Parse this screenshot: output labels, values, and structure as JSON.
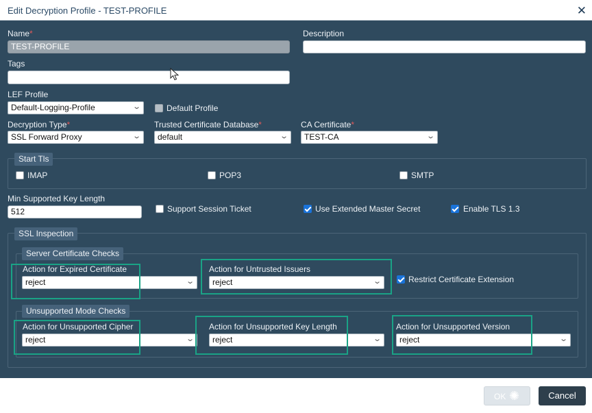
{
  "dialog": {
    "title": "Edit Decryption Profile - TEST-PROFILE"
  },
  "fields": {
    "name": {
      "label": "Name",
      "required": "*",
      "value": "TEST-PROFILE"
    },
    "description": {
      "label": "Description",
      "value": ""
    },
    "tags": {
      "label": "Tags",
      "value": ""
    },
    "lef_profile": {
      "label": "LEF Profile",
      "value": "Default-Logging-Profile"
    },
    "default_profile": {
      "label": "Default Profile",
      "checked": false
    },
    "decryption_type": {
      "label": "Decryption Type",
      "required": "*",
      "value": "SSL Forward Proxy"
    },
    "trusted_cert_db": {
      "label": "Trusted Certificate Database",
      "required": "*",
      "value": "default"
    },
    "ca_certificate": {
      "label": "CA Certificate",
      "required": "*",
      "value": "TEST-CA"
    }
  },
  "start_tls": {
    "legend": "Start Tls",
    "options": [
      {
        "label": "IMAP",
        "checked": false
      },
      {
        "label": "POP3",
        "checked": false
      },
      {
        "label": "SMTP",
        "checked": false
      }
    ]
  },
  "min_key_length": {
    "label": "Min Supported Key Length",
    "value": "512"
  },
  "options": {
    "support_session_ticket": {
      "label": "Support Session Ticket",
      "checked": false
    },
    "use_extended_master_secret": {
      "label": "Use Extended Master Secret",
      "checked": true
    },
    "enable_tls13": {
      "label": "Enable TLS 1.3",
      "checked": true
    }
  },
  "ssl_inspection": {
    "legend": "SSL Inspection",
    "server_cert_checks": {
      "legend": "Server Certificate Checks",
      "expired": {
        "label": "Action for Expired Certificate",
        "value": "reject"
      },
      "untrusted": {
        "label": "Action for Untrusted Issuers",
        "value": "reject"
      },
      "restrict_ext": {
        "label": "Restrict Certificate Extension",
        "checked": true
      }
    },
    "unsupported_mode_checks": {
      "legend": "Unsupported Mode Checks",
      "cipher": {
        "label": "Action for Unsupported Cipher",
        "value": "reject"
      },
      "key_length": {
        "label": "Action for Unsupported Key Length",
        "value": "reject"
      },
      "version": {
        "label": "Action for Unsupported Version",
        "value": "reject"
      }
    }
  },
  "footer": {
    "ok": "OK",
    "cancel": "Cancel"
  },
  "icons": {
    "close": "close-icon",
    "chevron": "chevron-down-icon",
    "spinner": "spinner-icon",
    "cursor": "mouse-pointer-icon"
  },
  "colors": {
    "background": "#2f4a5e",
    "highlight": "#1aa386",
    "checkbox": "#1a73d9",
    "required": "#e05a5a"
  }
}
